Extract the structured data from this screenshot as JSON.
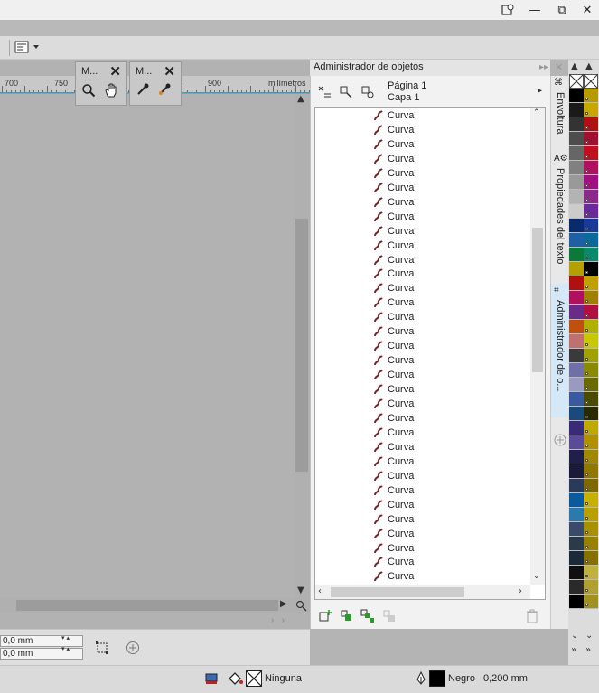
{
  "window": {
    "minimize_glyph": "—",
    "restore_glyph": "⧉",
    "close_glyph": "✕"
  },
  "ruler": {
    "labels": [
      "700",
      "750",
      "900",
      "milímetros"
    ]
  },
  "minibars": [
    {
      "title": "M...",
      "tools": [
        "zoom-icon",
        "pan-hand-icon"
      ]
    },
    {
      "title": "M...",
      "tools": [
        "eyedropper-icon",
        "attributes-eyedropper-icon"
      ]
    }
  ],
  "object_manager": {
    "title": "Administrador de objetos",
    "page": "Página 1",
    "layer": "Capa 1",
    "item_label": "Curva",
    "item_count": 33,
    "curve_color": "#6e2a2a"
  },
  "side_tabs": [
    {
      "label": "Envoltura",
      "icon": "envelope-icon"
    },
    {
      "label": "Propiedades del texto",
      "icon": "text-properties-icon"
    },
    {
      "label": "Administrador de o...",
      "icon": "object-manager-icon"
    }
  ],
  "coords": {
    "x": "0,0 mm",
    "y": "0,0 mm"
  },
  "status": {
    "fill_label": "Ninguna",
    "outline_label": "Negro",
    "outline_width": "0,200 mm",
    "outline_color": "#000000"
  },
  "palette": {
    "left": [
      "#000000",
      "#1a1a1a",
      "#333333",
      "#4d4d4d",
      "#666666",
      "#808080",
      "#999999",
      "#b3b3b3",
      "#cccccc",
      "#0a2a6e",
      "#1f5fa8",
      "#0a7a3a",
      "#b5a000",
      "#b01010",
      "#b01060",
      "#6a2a8a",
      "#c05010",
      "#c07070",
      "#3a3a3a",
      "#7070a8",
      "#9a9ac0",
      "#3a5aa0",
      "#1a4a7a",
      "#3a2a7a",
      "#5a4a9a",
      "#1f1f4a",
      "#1a1a3a",
      "#2a3a5a",
      "#0a5aa0",
      "#2a7ab0",
      "#3a4a6a",
      "#2a3a4a",
      "#1a2a3a",
      "#101010",
      "#2a2a2a",
      "#000000"
    ],
    "right": [
      "#b59a00",
      "#c8a800",
      "#b01010",
      "#a01030",
      "#c01020",
      "#b01060",
      "#a01080",
      "#8a2a8a",
      "#6a2a9a",
      "#1a3a9a",
      "#0a6a9a",
      "#0a8a6a",
      "#000000",
      "#c0a000",
      "#a08000",
      "#b01040",
      "#b0b000",
      "#c8c800",
      "#a0a000",
      "#8a8a00",
      "#6a6a00",
      "#4a4a00",
      "#2a2a00",
      "#c0a800",
      "#b09000",
      "#a08800",
      "#907800",
      "#806800",
      "#c8b000",
      "#b8a000",
      "#a89000",
      "#988000",
      "#887000",
      "#c0b040",
      "#b0a030",
      "#a09020"
    ]
  }
}
